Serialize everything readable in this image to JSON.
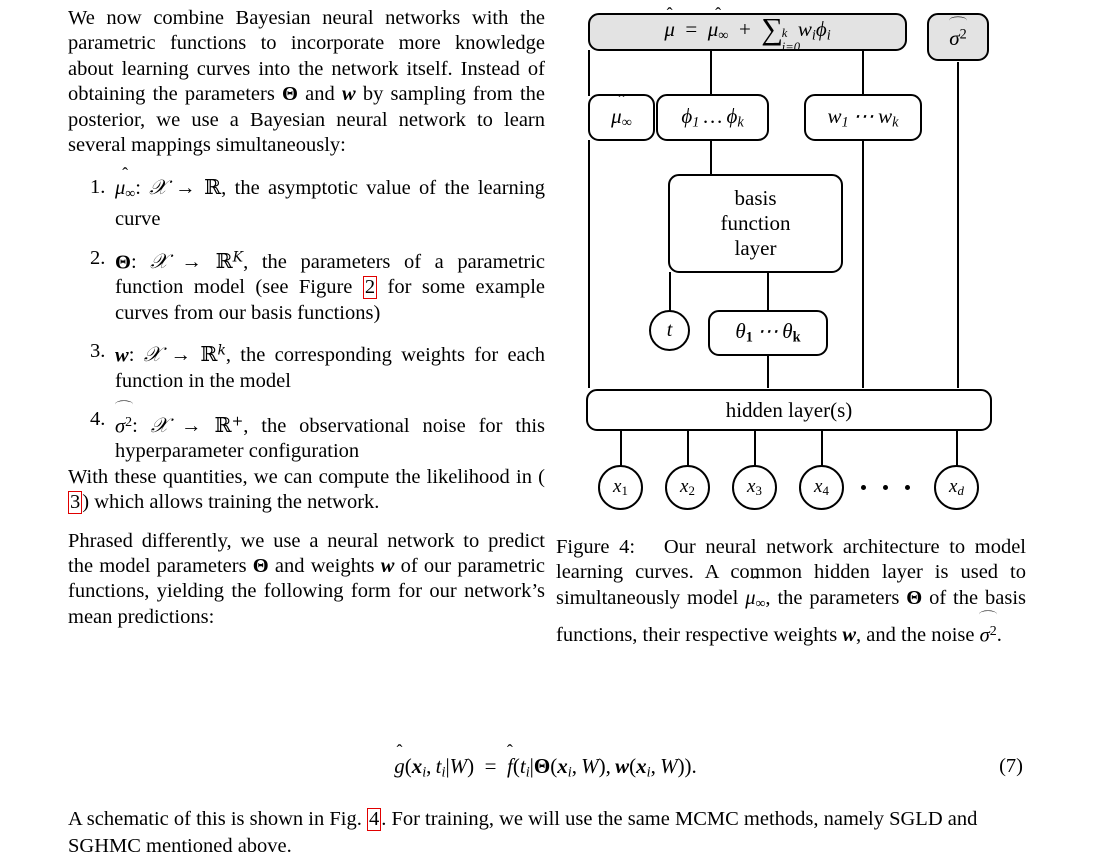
{
  "document": {
    "left_column": {
      "intro_paragraph": "We now combine Bayesian neural networks with the parametric functions to incorporate more knowledge about learning curves into the network itself. Instead of obtaining the parameters Θ and w by sampling from the posterior, we use a Bayesian neural network to learn several mappings simultaneously:",
      "list_items": [
        {
          "number": "1.",
          "symbol": "μ̂∞",
          "mapping": ": 𝒳 → ℝ,",
          "text": "the asymptotic value of the learning curve"
        },
        {
          "number": "2.",
          "symbol": "Θ",
          "mapping": ": 𝒳 → ℝ^K,",
          "text_before_ref": "the parameters of a parametric function model (see Figure",
          "ref": "2",
          "text_after_ref": "for some example curves from our basis functions)"
        },
        {
          "number": "3.",
          "symbol": "w",
          "mapping": ": 𝒳 → ℝ^k,",
          "text": "the corresponding weights for each function in the model"
        },
        {
          "number": "4.",
          "symbol": "σ̂²",
          "mapping": ": 𝒳 → ℝ^+,",
          "text": "the observational noise for this hyperparameter configuration"
        }
      ],
      "likelihood_paragraph_before_ref": "With these quantities, we can compute the likelihood in (",
      "likelihood_ref": "3",
      "likelihood_paragraph_after_ref": ") which allows training the network.",
      "phrased_paragraph": "Phrased differently, we use a neural network to predict the model parameters Θ and weights w of our parametric functions, yielding the following form for our network's mean predictions:"
    },
    "figure": {
      "nodes": {
        "output_equation": "μ̂ = μ̂∞ + ∑_{i=0}^{k} wᵢϕᵢ",
        "noise": "σ̂²",
        "mu_inf": "μ̂∞",
        "phis": "ϕ₁ … ϕₖ",
        "weights": "w₁ ⋯ wₖ",
        "basis_layer_line1": "basis",
        "basis_layer_line2": "function",
        "basis_layer_line3": "layer",
        "t_node": "t",
        "thetas": "θ₁ ⋯ θₖ",
        "hidden_layer": "hidden layer(s)",
        "inputs": [
          "x₁",
          "x₂",
          "x₃",
          "x₄",
          "x_d"
        ],
        "input_ellipsis": "• • •"
      },
      "caption_label": "Figure 4:",
      "caption_text": "Our neural network architecture to model learning curves. A common hidden layer is used to simultaneously model μ̂∞, the parameters Θ of the basis functions, their respective weights w, and the noise σ̂²."
    },
    "equation": {
      "body": "ĝ(xᵢ, tᵢ|W) = f̂(tᵢ|Θ(xᵢ, W), w(xᵢ, W)).",
      "tag": "(7)"
    },
    "bottom_paragraph": {
      "text_before_ref": "A schematic of this is shown in Fig.",
      "ref": "4",
      "text_after_ref": ". For training, we will use the same MCMC methods, namely SGLD and SGHMC mentioned above."
    }
  },
  "colors": {
    "text": "#000000",
    "page_background": "#ffffff",
    "link_box_border": "#e00000",
    "node_fill_gray": "#e3e3e3",
    "node_fill_white": "#ffffff",
    "node_stroke": "#000000"
  }
}
